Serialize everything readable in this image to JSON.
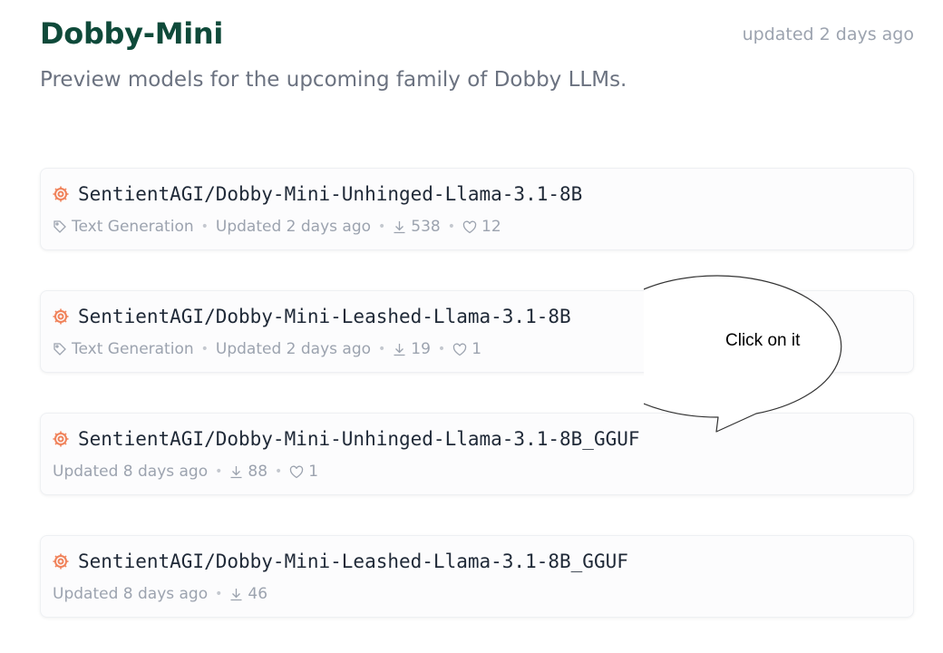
{
  "collection": {
    "title": "Dobby-Mini",
    "updated": "updated 2 days ago",
    "description": "Preview models for the upcoming family of Dobby LLMs."
  },
  "models": [
    {
      "name": "SentientAGI/Dobby-Mini-Unhinged-Llama-3.1-8B",
      "task": "Text Generation",
      "updated": "Updated 2 days ago",
      "downloads": "538",
      "likes": "12"
    },
    {
      "name": "SentientAGI/Dobby-Mini-Leashed-Llama-3.1-8B",
      "task": "Text Generation",
      "updated": "Updated 2 days ago",
      "downloads": "19",
      "likes": "1"
    },
    {
      "name": "SentientAGI/Dobby-Mini-Unhinged-Llama-3.1-8B_GGUF",
      "updated": "Updated 8 days ago",
      "downloads": "88",
      "likes": "1"
    },
    {
      "name": "SentientAGI/Dobby-Mini-Leashed-Llama-3.1-8B_GGUF",
      "updated": "Updated 8 days ago",
      "downloads": "46"
    }
  ],
  "callout": {
    "text": "Click on it"
  },
  "colors": {
    "title": "#0f4a3a",
    "org_icon": "#f0825a",
    "meta_text": "#9ca3af"
  },
  "icons": {
    "org": "sentient-org-icon",
    "task": "tag-icon",
    "downloads": "download-icon",
    "likes": "heart-icon"
  }
}
